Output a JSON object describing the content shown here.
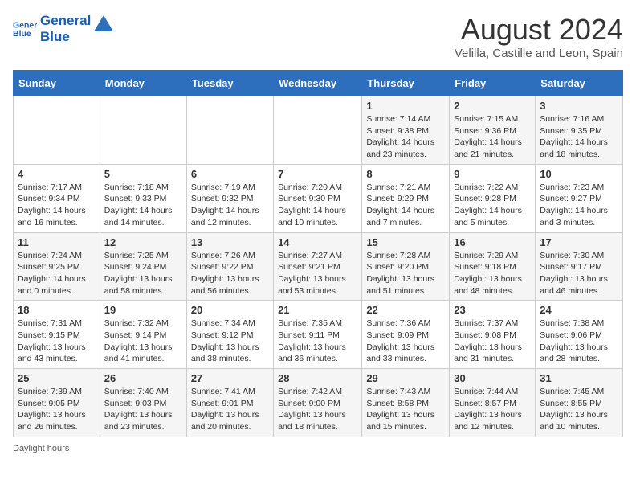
{
  "logo": {
    "line1": "General",
    "line2": "Blue"
  },
  "title": "August 2024",
  "subtitle": "Velilla, Castille and Leon, Spain",
  "days_of_week": [
    "Sunday",
    "Monday",
    "Tuesday",
    "Wednesday",
    "Thursday",
    "Friday",
    "Saturday"
  ],
  "weeks": [
    [
      {
        "day": "",
        "info": ""
      },
      {
        "day": "",
        "info": ""
      },
      {
        "day": "",
        "info": ""
      },
      {
        "day": "",
        "info": ""
      },
      {
        "day": "1",
        "info": "Sunrise: 7:14 AM\nSunset: 9:38 PM\nDaylight: 14 hours and 23 minutes."
      },
      {
        "day": "2",
        "info": "Sunrise: 7:15 AM\nSunset: 9:36 PM\nDaylight: 14 hours and 21 minutes."
      },
      {
        "day": "3",
        "info": "Sunrise: 7:16 AM\nSunset: 9:35 PM\nDaylight: 14 hours and 18 minutes."
      }
    ],
    [
      {
        "day": "4",
        "info": "Sunrise: 7:17 AM\nSunset: 9:34 PM\nDaylight: 14 hours and 16 minutes."
      },
      {
        "day": "5",
        "info": "Sunrise: 7:18 AM\nSunset: 9:33 PM\nDaylight: 14 hours and 14 minutes."
      },
      {
        "day": "6",
        "info": "Sunrise: 7:19 AM\nSunset: 9:32 PM\nDaylight: 14 hours and 12 minutes."
      },
      {
        "day": "7",
        "info": "Sunrise: 7:20 AM\nSunset: 9:30 PM\nDaylight: 14 hours and 10 minutes."
      },
      {
        "day": "8",
        "info": "Sunrise: 7:21 AM\nSunset: 9:29 PM\nDaylight: 14 hours and 7 minutes."
      },
      {
        "day": "9",
        "info": "Sunrise: 7:22 AM\nSunset: 9:28 PM\nDaylight: 14 hours and 5 minutes."
      },
      {
        "day": "10",
        "info": "Sunrise: 7:23 AM\nSunset: 9:27 PM\nDaylight: 14 hours and 3 minutes."
      }
    ],
    [
      {
        "day": "11",
        "info": "Sunrise: 7:24 AM\nSunset: 9:25 PM\nDaylight: 14 hours and 0 minutes."
      },
      {
        "day": "12",
        "info": "Sunrise: 7:25 AM\nSunset: 9:24 PM\nDaylight: 13 hours and 58 minutes."
      },
      {
        "day": "13",
        "info": "Sunrise: 7:26 AM\nSunset: 9:22 PM\nDaylight: 13 hours and 56 minutes."
      },
      {
        "day": "14",
        "info": "Sunrise: 7:27 AM\nSunset: 9:21 PM\nDaylight: 13 hours and 53 minutes."
      },
      {
        "day": "15",
        "info": "Sunrise: 7:28 AM\nSunset: 9:20 PM\nDaylight: 13 hours and 51 minutes."
      },
      {
        "day": "16",
        "info": "Sunrise: 7:29 AM\nSunset: 9:18 PM\nDaylight: 13 hours and 48 minutes."
      },
      {
        "day": "17",
        "info": "Sunrise: 7:30 AM\nSunset: 9:17 PM\nDaylight: 13 hours and 46 minutes."
      }
    ],
    [
      {
        "day": "18",
        "info": "Sunrise: 7:31 AM\nSunset: 9:15 PM\nDaylight: 13 hours and 43 minutes."
      },
      {
        "day": "19",
        "info": "Sunrise: 7:32 AM\nSunset: 9:14 PM\nDaylight: 13 hours and 41 minutes."
      },
      {
        "day": "20",
        "info": "Sunrise: 7:34 AM\nSunset: 9:12 PM\nDaylight: 13 hours and 38 minutes."
      },
      {
        "day": "21",
        "info": "Sunrise: 7:35 AM\nSunset: 9:11 PM\nDaylight: 13 hours and 36 minutes."
      },
      {
        "day": "22",
        "info": "Sunrise: 7:36 AM\nSunset: 9:09 PM\nDaylight: 13 hours and 33 minutes."
      },
      {
        "day": "23",
        "info": "Sunrise: 7:37 AM\nSunset: 9:08 PM\nDaylight: 13 hours and 31 minutes."
      },
      {
        "day": "24",
        "info": "Sunrise: 7:38 AM\nSunset: 9:06 PM\nDaylight: 13 hours and 28 minutes."
      }
    ],
    [
      {
        "day": "25",
        "info": "Sunrise: 7:39 AM\nSunset: 9:05 PM\nDaylight: 13 hours and 26 minutes."
      },
      {
        "day": "26",
        "info": "Sunrise: 7:40 AM\nSunset: 9:03 PM\nDaylight: 13 hours and 23 minutes."
      },
      {
        "day": "27",
        "info": "Sunrise: 7:41 AM\nSunset: 9:01 PM\nDaylight: 13 hours and 20 minutes."
      },
      {
        "day": "28",
        "info": "Sunrise: 7:42 AM\nSunset: 9:00 PM\nDaylight: 13 hours and 18 minutes."
      },
      {
        "day": "29",
        "info": "Sunrise: 7:43 AM\nSunset: 8:58 PM\nDaylight: 13 hours and 15 minutes."
      },
      {
        "day": "30",
        "info": "Sunrise: 7:44 AM\nSunset: 8:57 PM\nDaylight: 13 hours and 12 minutes."
      },
      {
        "day": "31",
        "info": "Sunrise: 7:45 AM\nSunset: 8:55 PM\nDaylight: 13 hours and 10 minutes."
      }
    ]
  ],
  "footer": "Daylight hours"
}
